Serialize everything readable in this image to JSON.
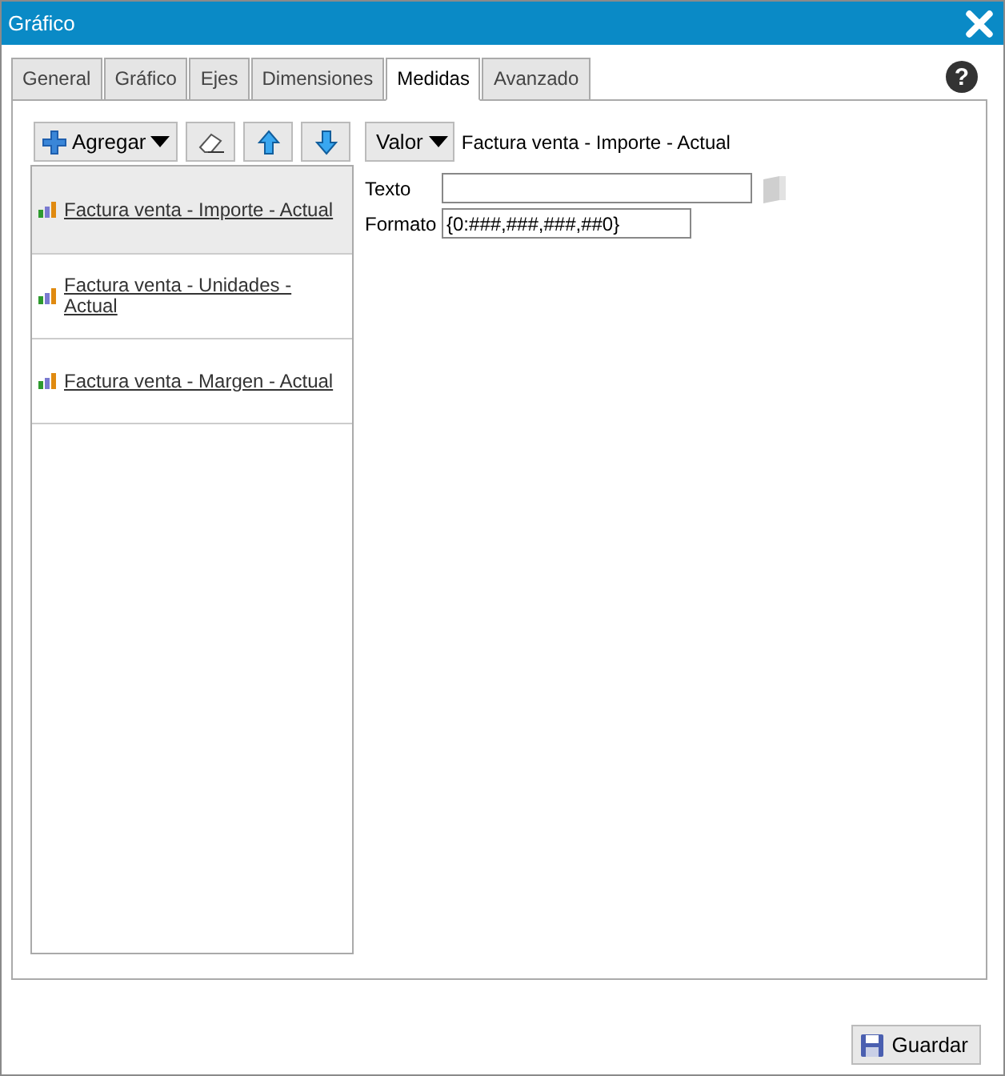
{
  "window": {
    "title": "Gráfico"
  },
  "tabs": [
    {
      "label": "General",
      "selected": false
    },
    {
      "label": "Gráfico",
      "selected": false
    },
    {
      "label": "Ejes",
      "selected": false
    },
    {
      "label": "Dimensiones",
      "selected": false
    },
    {
      "label": "Medidas",
      "selected": true
    },
    {
      "label": "Avanzado",
      "selected": false
    }
  ],
  "help": "?",
  "toolbar": {
    "add": "Agregar"
  },
  "measures": [
    {
      "label": "Factura venta - Importe - Actual",
      "selected": true
    },
    {
      "label": "Factura venta - Unidades - Actual",
      "selected": false
    },
    {
      "label": "Factura venta - Margen - Actual",
      "selected": false
    }
  ],
  "detail": {
    "type_button": "Valor",
    "measure": "Factura venta - Importe - Actual",
    "fields": [
      {
        "label": "Texto",
        "kind": "text-picker"
      },
      {
        "label": "Formato",
        "value": "{0:###,###,###,##0}",
        "kind": "text"
      }
    ]
  },
  "save_button": "Guardar"
}
